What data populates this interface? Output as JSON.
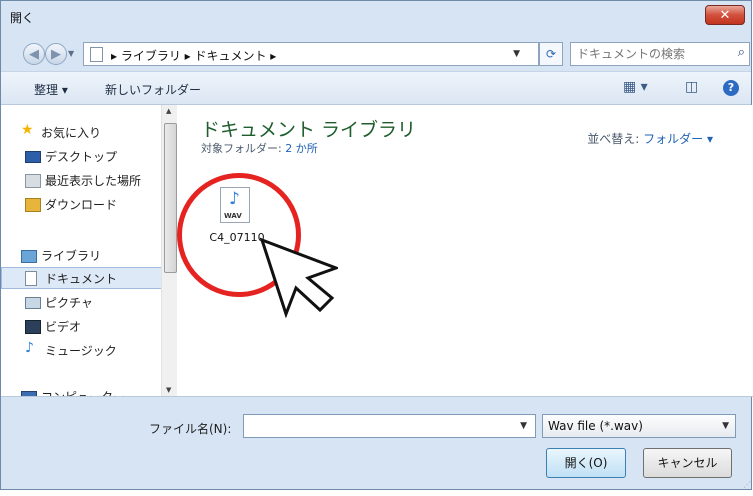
{
  "window": {
    "title": "開く",
    "close_label": "✕"
  },
  "address": {
    "crumbs": "▸ ライブラリ ▸ ドキュメント ▸",
    "search_placeholder": "ドキュメントの検索"
  },
  "toolbar": {
    "organize_label": "整理 ▾",
    "new_folder_label": "新しいフォルダー"
  },
  "nav": {
    "items": [
      {
        "label": "お気に入り"
      },
      {
        "label": "デスクトップ"
      },
      {
        "label": "最近表示した場所"
      },
      {
        "label": "ダウンロード"
      },
      {
        "label": "ライブラリ"
      },
      {
        "label": "ドキュメント"
      },
      {
        "label": "ピクチャ"
      },
      {
        "label": "ビデオ"
      },
      {
        "label": "ミュージック"
      },
      {
        "label": "コンピューター"
      }
    ]
  },
  "main": {
    "library_title": "ドキュメント ライブラリ",
    "target_label": "対象フォルダー:",
    "target_value": "2 か所",
    "sort_label": "並べ替え:",
    "sort_value": "フォルダー ▾",
    "file": {
      "name": "C4_07110",
      "type_badge": "WAV"
    }
  },
  "footer": {
    "filename_label": "ファイル名(N):",
    "filename_value": "",
    "filetype_value": "Wav file (*.wav)",
    "open_label": "開く(O)",
    "cancel_label": "キャンセル"
  },
  "colors": {
    "annotation": "#e52421",
    "library_title": "#1e5d2c",
    "link": "#1f62b6"
  }
}
